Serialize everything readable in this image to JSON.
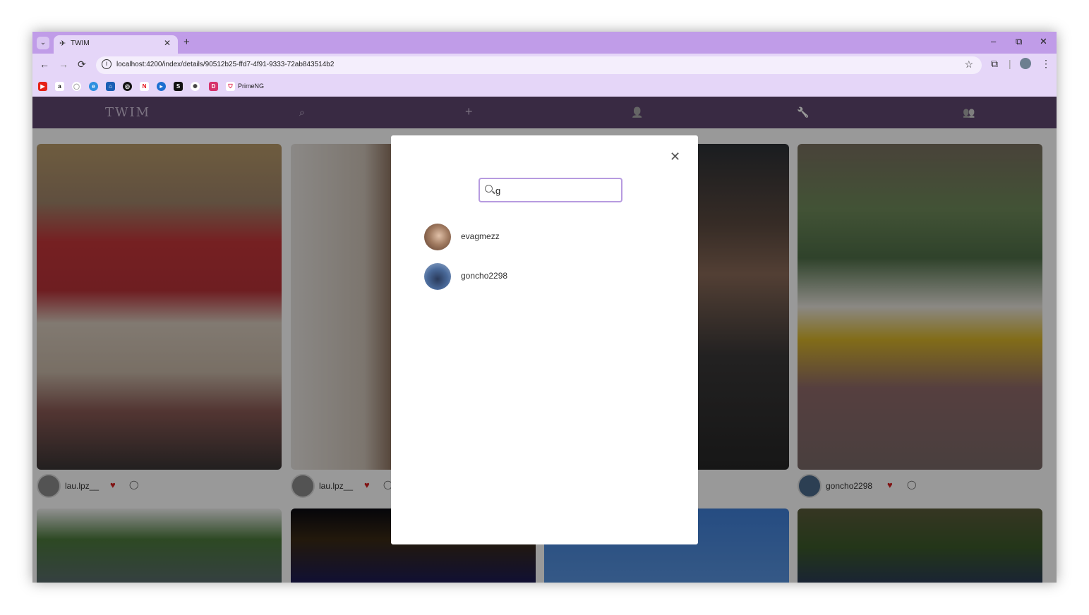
{
  "browser": {
    "tab_title": "TWIM",
    "tab_close": "✕",
    "new_tab": "+",
    "url": "localhost:4200/index/details/90512b25-ffd7-4f91-9333-72ab843514b2",
    "window_controls": {
      "minimize": "–",
      "restore": "⧉",
      "close": "✕"
    },
    "nav_icons": {
      "back": "←",
      "forward": "→",
      "reload": "⟳"
    },
    "bookmark_label": "PrimeNG",
    "bookmark_icons": [
      "youtube-icon",
      "amazon-icon",
      "github-icon",
      "edge-icon",
      "academic-icon",
      "chatgpt-icon",
      "netflix-icon",
      "play-icon",
      "s-icon",
      "openai-icon",
      "d-icon",
      "primeng-icon"
    ]
  },
  "app": {
    "brand": "TWIM",
    "nav_icons": [
      "search-icon",
      "plus-icon",
      "user-icon",
      "wrench-icon",
      "user-add-icon"
    ],
    "nav_glyphs": {
      "search": "⌕",
      "plus": "+",
      "user": "👤",
      "wrench": "🔧",
      "user_add": "👥"
    }
  },
  "posts": [
    {
      "user": "lau.lpz__"
    },
    {
      "user": "lau.lpz__"
    },
    {
      "user": "goncho2298"
    }
  ],
  "modal": {
    "close": "✕",
    "search_value": "g",
    "results": [
      {
        "username": "evagmezz"
      },
      {
        "username": "goncho2298"
      }
    ]
  },
  "colors": {
    "tabstrip": "#c09ce8",
    "toolbar": "#e5d6f8",
    "app_header": "#5f4770",
    "search_border": "#b79be0",
    "heart": "#d62020"
  }
}
